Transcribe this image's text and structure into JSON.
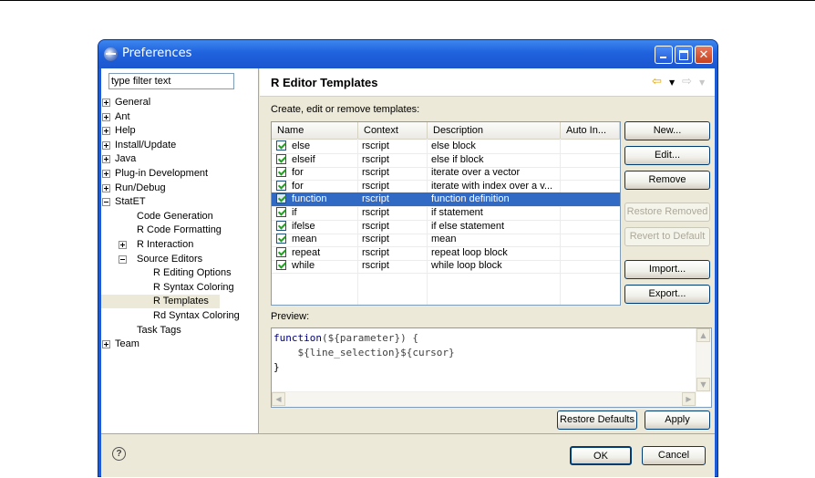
{
  "window": {
    "title": "Preferences"
  },
  "filter": {
    "placeholder": "type filter text"
  },
  "tree": [
    {
      "label": "General",
      "depth": 0,
      "expander": "plus"
    },
    {
      "label": "Ant",
      "depth": 0,
      "expander": "plus"
    },
    {
      "label": "Help",
      "depth": 0,
      "expander": "plus"
    },
    {
      "label": "Install/Update",
      "depth": 0,
      "expander": "plus"
    },
    {
      "label": "Java",
      "depth": 0,
      "expander": "plus"
    },
    {
      "label": "Plug-in Development",
      "depth": 0,
      "expander": "plus"
    },
    {
      "label": "Run/Debug",
      "depth": 0,
      "expander": "plus"
    },
    {
      "label": "StatET",
      "depth": 0,
      "expander": "minus"
    },
    {
      "label": "Code Generation",
      "depth": 1,
      "expander": "none"
    },
    {
      "label": "R Code Formatting",
      "depth": 1,
      "expander": "none"
    },
    {
      "label": "R Interaction",
      "depth": 1,
      "expander": "plus"
    },
    {
      "label": "Source Editors",
      "depth": 1,
      "expander": "minus"
    },
    {
      "label": "R Editing Options",
      "depth": 2,
      "expander": "none"
    },
    {
      "label": "R Syntax Coloring",
      "depth": 2,
      "expander": "none"
    },
    {
      "label": "R Templates",
      "depth": 2,
      "expander": "none",
      "selected": true
    },
    {
      "label": "Rd Syntax Coloring",
      "depth": 2,
      "expander": "none"
    },
    {
      "label": "Task Tags",
      "depth": 1,
      "expander": "none"
    },
    {
      "label": "Team",
      "depth": 0,
      "expander": "plus"
    }
  ],
  "pane": {
    "title": "R Editor Templates",
    "instructions": "Create, edit or remove templates:",
    "columns": [
      "Name",
      "Context",
      "Description",
      "Auto In..."
    ],
    "templates": [
      {
        "name": "else",
        "context": "rscript",
        "description": "else block",
        "checked": true
      },
      {
        "name": "elseif",
        "context": "rscript",
        "description": "else if block",
        "checked": true
      },
      {
        "name": "for",
        "context": "rscript",
        "description": "iterate over a vector",
        "checked": true
      },
      {
        "name": "for",
        "context": "rscript",
        "description": "iterate with index over a v...",
        "checked": true
      },
      {
        "name": "function",
        "context": "rscript",
        "description": "function definition",
        "checked": true,
        "selected": true
      },
      {
        "name": "if",
        "context": "rscript",
        "description": "if statement",
        "checked": true
      },
      {
        "name": "ifelse",
        "context": "rscript",
        "description": "if else statement",
        "checked": true
      },
      {
        "name": "mean",
        "context": "rscript",
        "description": "mean",
        "checked": true
      },
      {
        "name": "repeat",
        "context": "rscript",
        "description": "repeat loop block",
        "checked": true
      },
      {
        "name": "while",
        "context": "rscript",
        "description": "while loop block",
        "checked": true
      }
    ],
    "buttons": {
      "new": "New...",
      "edit": "Edit...",
      "remove": "Remove",
      "restore_removed": "Restore Removed",
      "revert": "Revert to Default",
      "import": "Import...",
      "export": "Export..."
    },
    "preview_label": "Preview:",
    "preview_lines": [
      {
        "kw": "function",
        "rest": "(${parameter}) {"
      },
      {
        "kw": "",
        "rest": "    ${line_selection}${cursor}"
      },
      {
        "kw": "",
        "rest": "}"
      }
    ],
    "restore_defaults": "Restore Defaults",
    "apply": "Apply"
  },
  "footer": {
    "ok": "OK",
    "cancel": "Cancel",
    "help": "?"
  },
  "colors": {
    "selection": "#316ac5",
    "titlebar": "#1f62dd",
    "dialog_bg": "#ece9d8"
  }
}
